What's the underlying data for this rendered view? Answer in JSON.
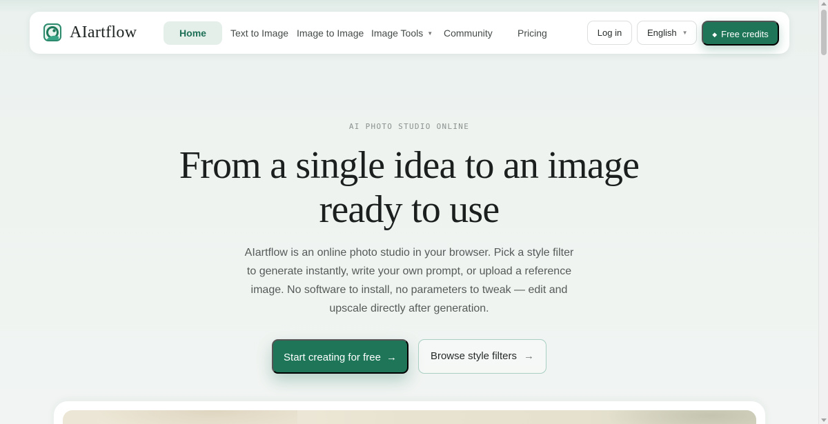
{
  "brand": {
    "name": "AIartflow",
    "logo_icon": "aiartflow-logo-icon",
    "accent_color": "#1e7558"
  },
  "nav": {
    "links": [
      {
        "label": "Home",
        "active": true
      },
      {
        "label": "Text to Image"
      },
      {
        "label": "Image to Image"
      },
      {
        "label": "Image Tools",
        "has_dropdown": true
      },
      {
        "label": "Community"
      },
      {
        "label": "Pricing"
      }
    ],
    "dropdown_caret": "▼",
    "login_label": "Log in",
    "language_label": "English",
    "credits_icon": "◆",
    "credits_label": "Free credits"
  },
  "hero": {
    "eyebrow": "AI PHOTO STUDIO ONLINE",
    "headline": "From a single idea to an image ready to use",
    "subtext": "AIartflow is an online photo studio in your browser. Pick a style filter to generate instantly, write your own prompt, or upload a reference image. No software to install, no parameters to tweak — edit and upscale directly after generation.",
    "primary_cta": "Start creating for free",
    "secondary_cta": "Browse style filters",
    "arrow": "→"
  }
}
